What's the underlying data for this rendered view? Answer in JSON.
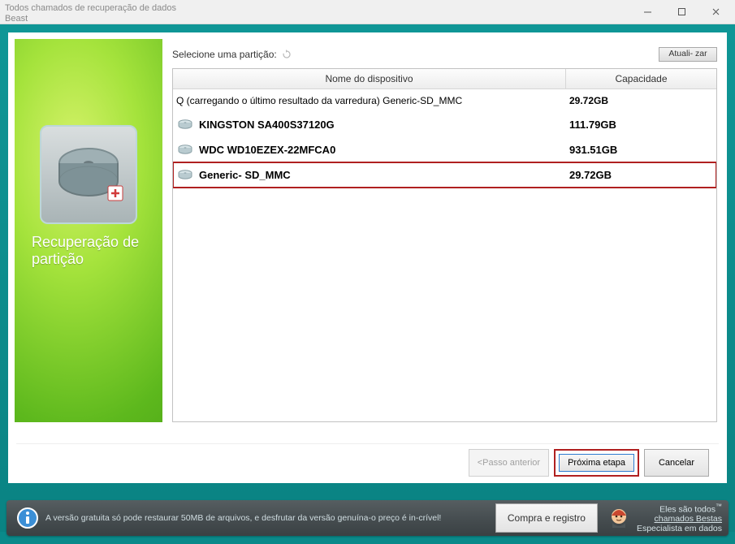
{
  "window": {
    "title": "Todos chamados de recuperação de dados Beast"
  },
  "sidebar": {
    "title": "Recuperação de partição"
  },
  "main": {
    "select_label": "Selecione uma partição:",
    "refresh_label": "Atuali-\nzar",
    "columns": {
      "device": "Nome do dispositivo",
      "capacity": "Capacidade"
    },
    "scan_result": {
      "label": "Q (carregando o último resultado da varredura) Generic-SD_MMC",
      "capacity": "29.72GB"
    },
    "devices": [
      {
        "name": "KINGSTON SA400S37120G",
        "capacity": "111.79GB",
        "selected": false
      },
      {
        "name": "WDC WD10EZEX-22MFCA0",
        "capacity": "931.51GB",
        "selected": false
      },
      {
        "name": "Generic- SD_MMC",
        "capacity": "29.72GB",
        "selected": true
      }
    ]
  },
  "nav": {
    "prev": "<Passo anterior",
    "next": "Próxima etapa",
    "cancel": "Cancelar"
  },
  "footer": {
    "text": "A versão gratuita só pode restaurar 50MB de arquivos, e desfrutar da versão genuína-o preço é in-crível!",
    "buy": "Compra e registro",
    "badge_line1": "Eles são todos",
    "badge_line2": "chamados Bestas",
    "badge_line3": "Especialista em dados"
  }
}
